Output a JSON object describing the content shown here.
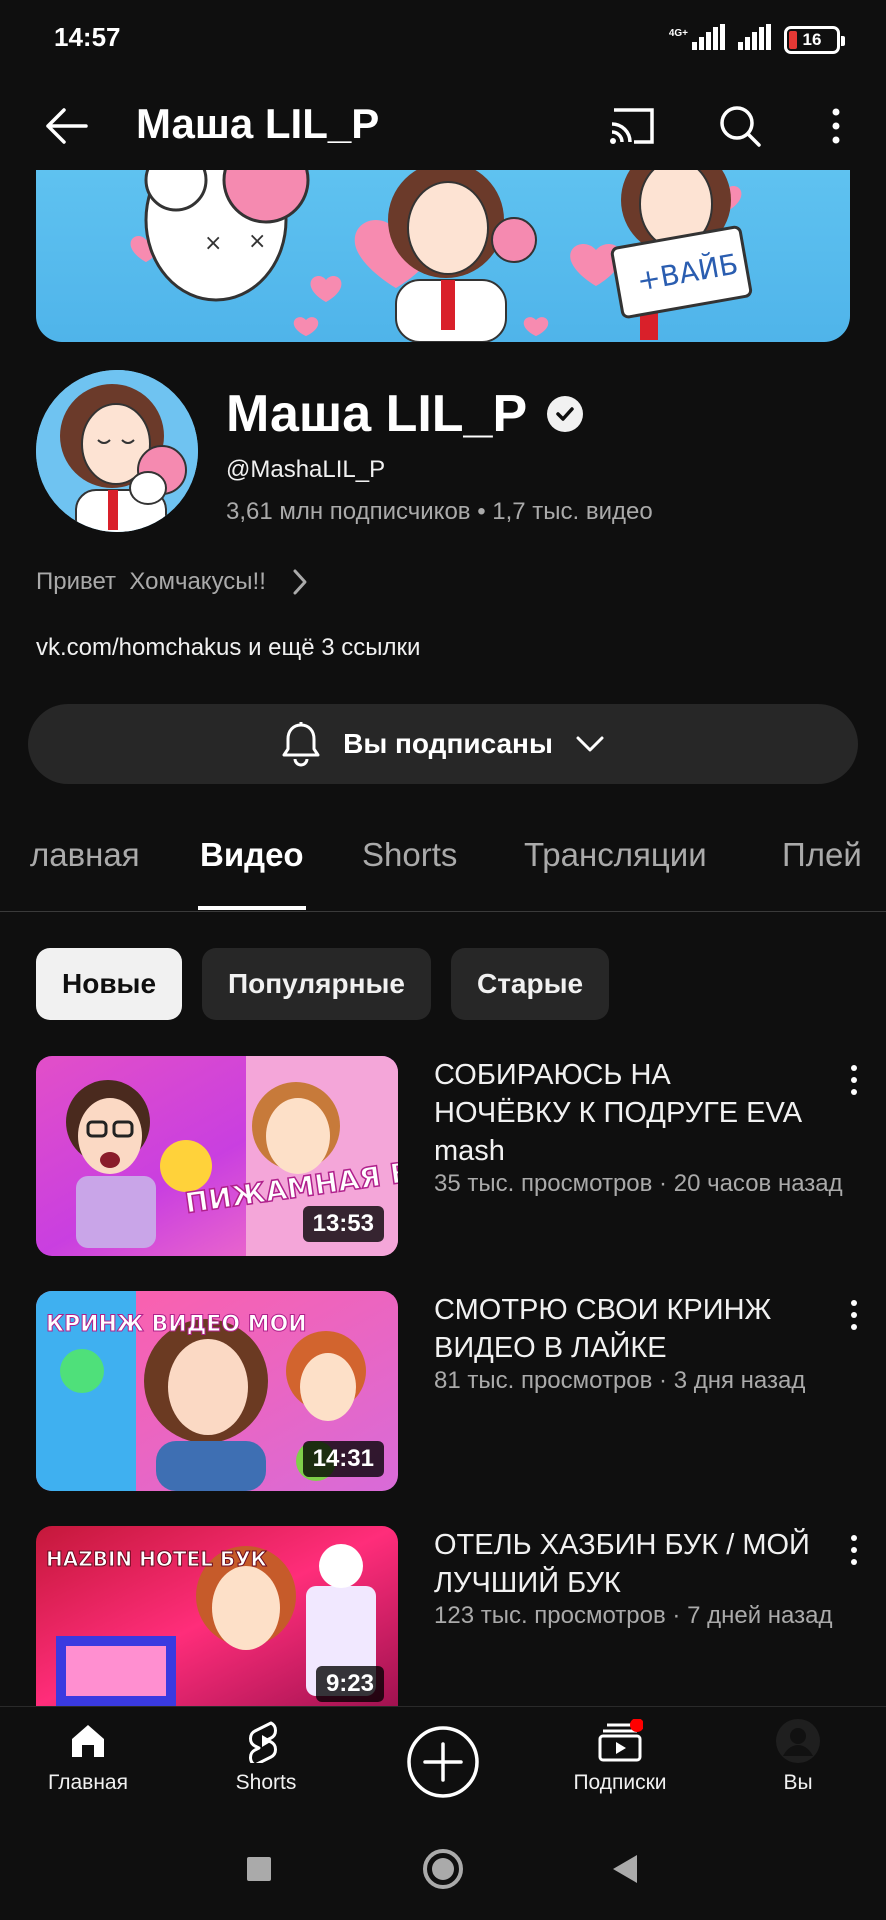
{
  "status_bar": {
    "time": "14:57",
    "network": "4G+",
    "battery_level": "16",
    "battery_color": "#e53935"
  },
  "app_bar": {
    "title": "Маша LIL_P",
    "icons": [
      "back-arrow-icon",
      "cast-icon",
      "search-icon",
      "more-vert-icon"
    ]
  },
  "channel": {
    "name": "Маша LIL_P",
    "handle": "@MashaLIL_P",
    "stats": "3,61 млн подписчиков • 1,7 тыс. видео",
    "description": "Привет  Хомчакусы!!",
    "links_text": "vk.com/homchakus и ещё 3 ссылки",
    "banner_text": "+ВАЙБ"
  },
  "subscribe": {
    "label": "Вы подписаны"
  },
  "tabs": [
    {
      "label": "лавная",
      "active": false
    },
    {
      "label": "Видео",
      "active": true
    },
    {
      "label": "Shorts",
      "active": false
    },
    {
      "label": "Трансляции",
      "active": false
    },
    {
      "label": "Плей",
      "active": false
    }
  ],
  "filters": [
    {
      "label": "Новые",
      "selected": true
    },
    {
      "label": "Популярные",
      "selected": false
    },
    {
      "label": "Старые",
      "selected": false
    }
  ],
  "videos": [
    {
      "title": "СОБИРАЮСЬ НА НОЧЁВКУ К ПОДРУГЕ EVA mash",
      "meta": "35 тыс. просмотров · 20 часов назад",
      "duration": "13:53",
      "thumb_text": "ПИЖАМНАЯ ВЕЧЕР"
    },
    {
      "title": "СМОТРЮ СВОИ КРИНЖ ВИДЕО В ЛАЙКЕ",
      "meta": "81 тыс. просмотров · 3 дня назад",
      "duration": "14:31",
      "thumb_text": "КРИНЖ ВИДЕО МОИ"
    },
    {
      "title": "ОТЕЛЬ ХАЗБИН БУК / МОЙ ЛУЧШИЙ БУК",
      "meta": "123 тыс. просмотров · 7 дней назад",
      "duration": "9:23",
      "thumb_text": "HAZBIN HOTEL БУК"
    }
  ],
  "bottom_nav": [
    {
      "label": "Главная",
      "icon": "home-icon"
    },
    {
      "label": "Shorts",
      "icon": "shorts-icon"
    },
    {
      "label": "",
      "icon": "create-icon"
    },
    {
      "label": "Подписки",
      "icon": "subscriptions-icon"
    },
    {
      "label": "Вы",
      "icon": "account-icon"
    }
  ],
  "colors": {
    "background": "#0f0f0f",
    "chip": "#272727",
    "text_secondary": "#aaaaaa",
    "notification_dot": "#ff0000"
  }
}
